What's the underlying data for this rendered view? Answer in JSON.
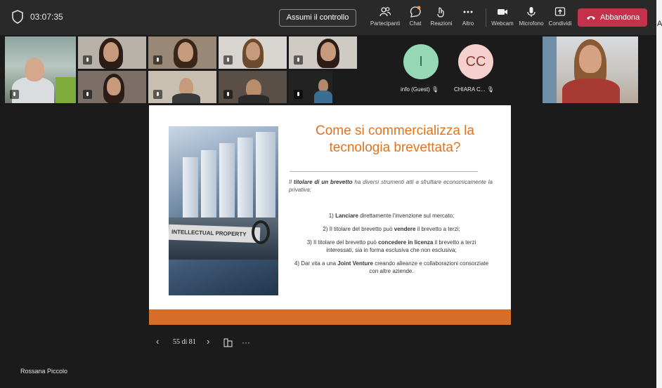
{
  "call": {
    "timer": "03:07:35",
    "take_control": "Assumi il controllo",
    "toolbar": [
      {
        "label": "Partecipanti",
        "icon": "people-icon"
      },
      {
        "label": "Chat",
        "icon": "chat-icon"
      },
      {
        "label": "Reazioni",
        "icon": "reactions-icon"
      },
      {
        "label": "Altro",
        "icon": "more-icon"
      },
      {
        "label": "Webcam",
        "icon": "camera-icon"
      },
      {
        "label": "Microfono",
        "icon": "microphone-icon"
      },
      {
        "label": "Condividi",
        "icon": "share-icon"
      }
    ],
    "leave": "Abbandona",
    "leave_color": "#c4314b",
    "side_panel_letter": "A"
  },
  "participants": {
    "avatars": [
      {
        "initials": "I",
        "label": "info (Guest)",
        "color": "#96d8b6"
      },
      {
        "initials": "CC",
        "label": "CHIARA C...",
        "color": "#f6d0cc"
      }
    ],
    "presenter_name": "Rossana Piccolo"
  },
  "slide": {
    "title": "Come si commercializza la tecnologia brevettata?",
    "photo_label": "INTELLECTUAL PROPERTY",
    "intro_bold": "titolare di un brevetto",
    "intro_before": "Il",
    "intro_after": "ha diversi strumenti atti a sfruttare economicamente la privativa:",
    "items": [
      {
        "pre": "1) ",
        "bold": "Lanciare",
        "post": " direttamente l'invenzione sul mercato;"
      },
      {
        "pre": "2) Il titolare del brevetto può ",
        "bold": "vendere",
        "post": " il brevetto a terzi;"
      },
      {
        "pre": "3) Il titolare del brevetto può ",
        "bold": "concedere in licenza",
        "post": " il brevetto a terzi interessati, sia in forma esclusiva che non esclusiva;"
      },
      {
        "pre": "4) Dar vita a una ",
        "bold": "Joint Venture",
        "post": " creando alleanze e collaborazioni consorziate con altre aziende."
      }
    ],
    "accent_color": "#e0731f"
  },
  "slide_nav": {
    "prev": "‹",
    "page": "55 di 81",
    "next": "›",
    "more": "···"
  }
}
